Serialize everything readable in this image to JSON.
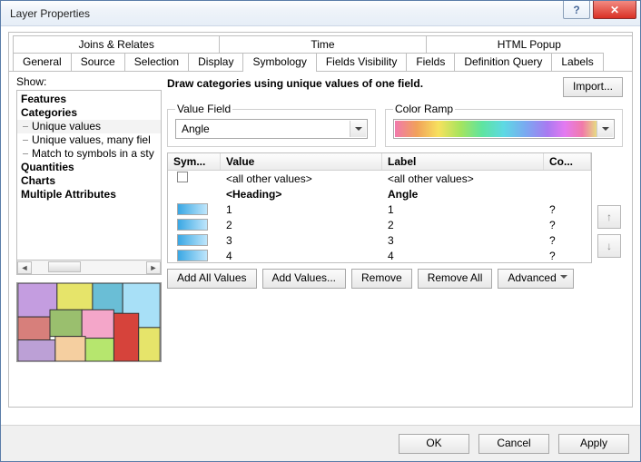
{
  "title": "Layer Properties",
  "tabs_row1": [
    "Joins & Relates",
    "Time",
    "HTML Popup"
  ],
  "tabs_row2": [
    "General",
    "Source",
    "Selection",
    "Display",
    "Symbology",
    "Fields Visibility",
    "Fields",
    "Definition Query",
    "Labels"
  ],
  "active_tab": "Symbology",
  "show_label": "Show:",
  "show_tree": {
    "n0": "Features",
    "n1": "Categories",
    "n1a": "Unique values",
    "n1b": "Unique values, many fiel",
    "n1c": "Match to symbols in a sty",
    "n2": "Quantities",
    "n3": "Charts",
    "n4": "Multiple Attributes"
  },
  "description": "Draw categories using unique values of one field.",
  "import_btn": "Import...",
  "value_field": {
    "legend": "Value Field",
    "value": "Angle"
  },
  "color_ramp": {
    "legend": "Color Ramp"
  },
  "grid": {
    "headers": {
      "sym": "Sym...",
      "value": "Value",
      "label": "Label",
      "count": "Co..."
    },
    "all_other": {
      "value": "<all other values>",
      "label": "<all other values>",
      "count": ""
    },
    "heading": {
      "value": "<Heading>",
      "label": "Angle"
    },
    "rows": [
      {
        "value": "1",
        "label": "1",
        "count": "?"
      },
      {
        "value": "2",
        "label": "2",
        "count": "?"
      },
      {
        "value": "3",
        "label": "3",
        "count": "?"
      },
      {
        "value": "4",
        "label": "4",
        "count": "?"
      }
    ]
  },
  "buttons": {
    "add_all": "Add All Values",
    "add": "Add Values...",
    "remove": "Remove",
    "remove_all": "Remove All",
    "advanced": "Advanced"
  },
  "footer": {
    "ok": "OK",
    "cancel": "Cancel",
    "apply": "Apply"
  }
}
